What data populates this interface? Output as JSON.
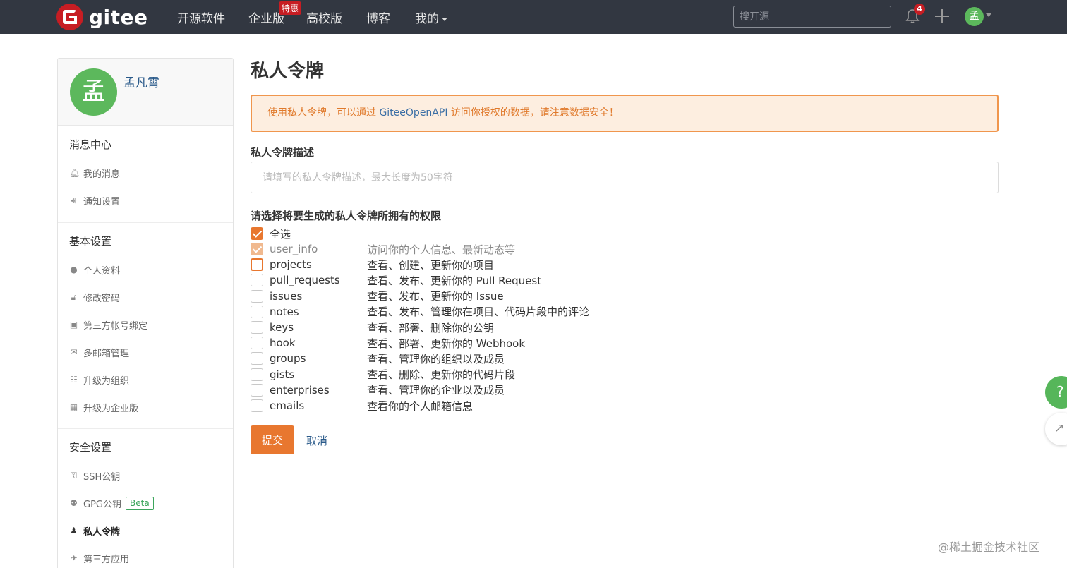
{
  "topnav": {
    "logo_text": "gitee",
    "items": [
      "开源软件",
      "企业版",
      "高校版",
      "博客",
      "我的"
    ],
    "badge": "特惠",
    "search_placeholder": "搜开源",
    "notification_count": "4",
    "avatar_initial": "孟",
    "bg_color": "#323741"
  },
  "sidebar": {
    "profile": {
      "avatar_initial": "孟",
      "name": "孟凡霄"
    },
    "sections": [
      {
        "title": "消息中心",
        "items": [
          {
            "icon": "bell-icon",
            "label": "我的消息"
          },
          {
            "icon": "speaker-icon",
            "label": "通知设置"
          }
        ]
      },
      {
        "title": "基本设置",
        "items": [
          {
            "icon": "user-icon",
            "label": "个人资料"
          },
          {
            "icon": "unlock-icon",
            "label": "修改密码"
          },
          {
            "icon": "id-card-icon",
            "label": "第三方帐号绑定"
          },
          {
            "icon": "envelope-icon",
            "label": "多邮箱管理"
          },
          {
            "icon": "users-icon",
            "label": "升级为组织"
          },
          {
            "icon": "building-icon",
            "label": "升级为企业版"
          }
        ]
      },
      {
        "title": "安全设置",
        "items": [
          {
            "icon": "key-icon",
            "label": "SSH公钥"
          },
          {
            "icon": "gpg-icon",
            "label": "GPG公钥",
            "badge": "Beta"
          },
          {
            "icon": "spy-icon",
            "label": "私人令牌",
            "active": true
          },
          {
            "icon": "rocket-icon",
            "label": "第三方应用"
          }
        ]
      }
    ]
  },
  "main": {
    "title": "私人令牌",
    "alert": {
      "prefix": "使用私人令牌，可以通过 ",
      "api": "GiteeOpenAPI",
      "suffix": " 访问你授权的数据，请注意数据安全！"
    },
    "desc_label": "私人令牌描述",
    "desc_placeholder": "请填写的私人令牌描述，最大长度为50字符",
    "perm_label": "请选择将要生成的私人令牌所拥有的权限",
    "select_all": "全选",
    "permissions": [
      {
        "name": "user_info",
        "desc": "访问你的个人信息、最新动态等",
        "state": "checked-disabled"
      },
      {
        "name": "projects",
        "desc": "查看、创建、更新你的项目",
        "state": "focus"
      },
      {
        "name": "pull_requests",
        "desc": "查看、发布、更新你的 Pull Request",
        "state": "unchecked"
      },
      {
        "name": "issues",
        "desc": "查看、发布、更新你的 Issue",
        "state": "unchecked"
      },
      {
        "name": "notes",
        "desc": "查看、发布、管理你在项目、代码片段中的评论",
        "state": "unchecked"
      },
      {
        "name": "keys",
        "desc": "查看、部署、删除你的公钥",
        "state": "unchecked"
      },
      {
        "name": "hook",
        "desc": "查看、部署、更新你的 Webhook",
        "state": "unchecked"
      },
      {
        "name": "groups",
        "desc": "查看、管理你的组织以及成员",
        "state": "unchecked"
      },
      {
        "name": "gists",
        "desc": "查看、删除、更新你的代码片段",
        "state": "unchecked"
      },
      {
        "name": "enterprises",
        "desc": "查看、管理你的企业以及成员",
        "state": "unchecked"
      },
      {
        "name": "emails",
        "desc": "查看你的个人邮箱信息",
        "state": "unchecked"
      }
    ],
    "submit_label": "提交",
    "cancel_label": "取消",
    "accent_color": "#e8772f"
  },
  "floating": {
    "help": "?",
    "watermark": "@稀土掘金技术社区"
  }
}
